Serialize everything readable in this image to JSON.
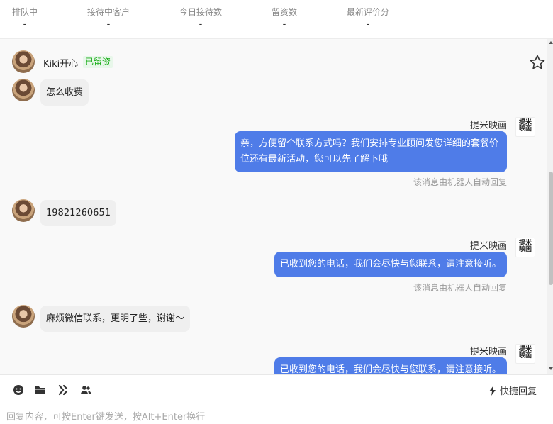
{
  "stats": [
    {
      "label": "排队中",
      "value": "-"
    },
    {
      "label": "接待中客户",
      "value": "-"
    },
    {
      "label": "今日接待数",
      "value": "-"
    },
    {
      "label": "留资数",
      "value": "-"
    },
    {
      "label": "最新评价分",
      "value": "-"
    }
  ],
  "customer": {
    "name": "Kiki开心",
    "tag": "已留资"
  },
  "brand": {
    "name": "提米映画",
    "avatar_text": "提米映画"
  },
  "messages": [
    {
      "text": "怎么收费"
    },
    {
      "sender": "提米映画",
      "text": "亲，方便留个联系方式吗？我们安排专业顾问发您详细的套餐价位还有最新活动，您可以先了解下哦",
      "note": "该消息由机器人自动回复"
    },
    {
      "text": "19821260651"
    },
    {
      "sender": "提米映画",
      "text": "已收到您的电话，我们会尽快与您联系，请注意接听。",
      "note": "该消息由机器人自动回复"
    },
    {
      "text": "麻烦微信联系，更明了些，谢谢～"
    },
    {
      "sender": "提米映画",
      "text": "已收到您的电话，我们会尽快与您联系，请注意接听。"
    }
  ],
  "composer": {
    "quick_reply_label": "快捷回复",
    "placeholder": "回复内容，可按Enter键发送，按Alt+Enter换行"
  },
  "icons": [
    "emoji-icon",
    "folder-icon",
    "shortcut-icon",
    "contacts-icon",
    "lightning-icon",
    "star-icon"
  ],
  "colors": {
    "accent": "#4f7ce8",
    "tag_green": "#1aad19"
  }
}
